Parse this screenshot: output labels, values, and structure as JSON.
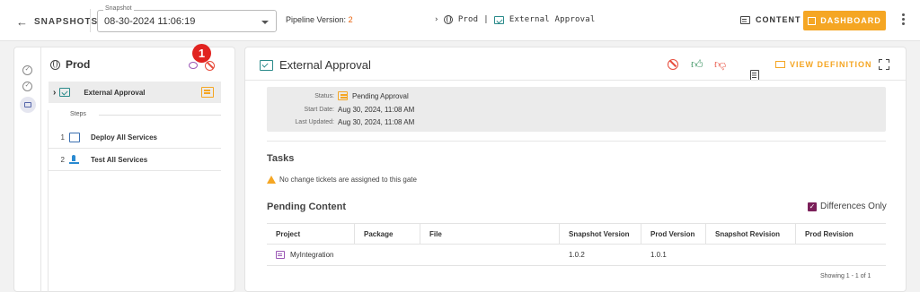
{
  "topbar": {
    "back_label": "SNAPSHOTS",
    "snapshot_legend": "Snapshot",
    "snapshot_value": "08-30-2024 11:06:19",
    "pipeline_version_label": "Pipeline Version:",
    "pipeline_version_value": "2",
    "breadcrumb_env": "Prod",
    "breadcrumb_sep": "|",
    "breadcrumb_gate": "External Approval",
    "content_label": "CONTENT",
    "dashboard_label": "DASHBOARD"
  },
  "left_panel": {
    "env_title": "Prod",
    "badge_number": "1",
    "selected_gate": "External Approval",
    "steps_label": "Steps",
    "steps": [
      {
        "number": "1",
        "label": "Deploy All Services",
        "icon": "deploy-icon"
      },
      {
        "number": "2",
        "label": "Test All Services",
        "icon": "test-icon"
      }
    ]
  },
  "main": {
    "title": "External Approval",
    "view_definition_label": "VIEW DEFINITION",
    "info": {
      "status_key": "Status:",
      "status_value": "Pending Approval",
      "start_key": "Start Date:",
      "start_value": "Aug 30, 2024, 11:08 AM",
      "updated_key": "Last Updated:",
      "updated_value": "Aug 30, 2024, 11:08 AM"
    },
    "tasks_heading": "Tasks",
    "tasks_warning": "No change tickets are assigned to this gate",
    "pending_heading": "Pending Content",
    "differences_only_label": "Differences Only",
    "differences_only_checked": true,
    "table": {
      "columns": [
        "Project",
        "Package",
        "File",
        "Snapshot Version",
        "Prod Version",
        "Snapshot Revision",
        "Prod Revision"
      ],
      "rows": [
        [
          "MyIntegration",
          "",
          "",
          "1.0.2",
          "1.0.1",
          "",
          ""
        ]
      ]
    },
    "showing_text": "Showing 1 - 1 of 1"
  },
  "colors": {
    "accent": "#f5a623",
    "badge": "#e12320",
    "version_number": "#e8600a",
    "approve": "#2e8b57",
    "reject": "#e74c3c",
    "checkbox": "#7b1f5a"
  }
}
